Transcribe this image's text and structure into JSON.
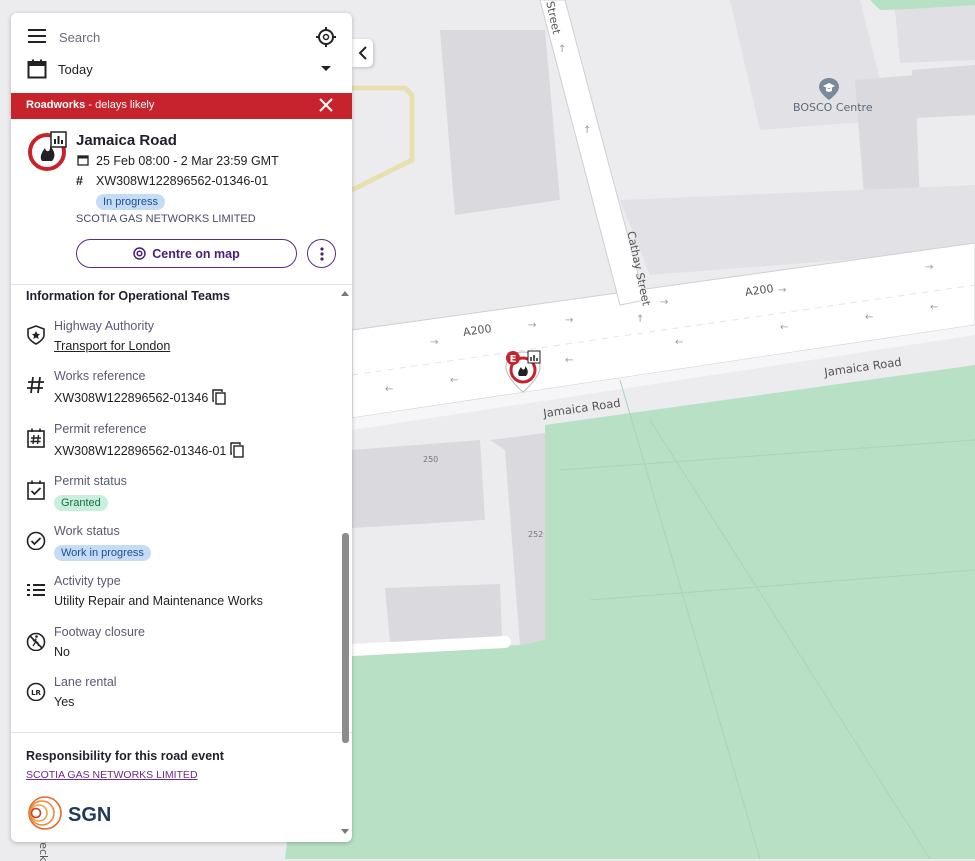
{
  "map": {
    "streets": {
      "street_top": "Street",
      "cathay_street": "Cathay Street",
      "a200_left": "A200",
      "a200_right": "A200",
      "jamaica_road_right": "Jamaica Road",
      "jamaica_road_left": "Jamaica Road",
      "peck_street": "Peck"
    },
    "poi": {
      "bosco_centre": "BOSCO Centre"
    },
    "building_numbers": {
      "n250": "250",
      "n252": "252"
    },
    "colors": {
      "park": "#b7e0c4",
      "road": "#ffffff",
      "building": "#d9d9de",
      "base": "#ececef"
    }
  },
  "search": {
    "placeholder": "Search",
    "value": ""
  },
  "date_filter": {
    "value": "Today"
  },
  "banner": {
    "bold": "Roadworks",
    "rest": " - delays likely",
    "color": "#c7232c"
  },
  "event": {
    "title": "Jamaica Road",
    "dates": "25 Feb 08:00 - 2 Mar 23:59 GMT",
    "reference": "XW308W122896562-01346-01",
    "status": "In progress",
    "organisation": "SCOTIA GAS NETWORKS LIMITED",
    "centre_button": "Centre on map"
  },
  "info": {
    "heading": "Information for Operational Teams",
    "items": [
      {
        "label": "Highway Authority",
        "value": "Transport for London",
        "icon": "shield-star-icon"
      },
      {
        "label": "Works reference",
        "value": "XW308W122896562-01346",
        "icon": "hash-icon"
      },
      {
        "label": "Permit reference",
        "value": "XW308W122896562-01346-01",
        "icon": "permit-hash-icon"
      },
      {
        "label": "Permit status",
        "value": "Granted",
        "icon": "clipboard-check-icon"
      },
      {
        "label": "Work status",
        "value": "Work in progress",
        "icon": "check-circle-icon"
      },
      {
        "label": "Activity type",
        "value": "Utility Repair and Maintenance Works",
        "icon": "list-icon"
      },
      {
        "label": "Footway closure",
        "value": "No",
        "icon": "no-pedestrian-icon"
      },
      {
        "label": "Lane rental",
        "value": "Yes",
        "icon": "lane-rental-icon"
      }
    ]
  },
  "responsibility": {
    "heading": "Responsibility for this road event",
    "link": "SCOTIA GAS NETWORKS LIMITED",
    "logo_text": "SGN",
    "lane_rental_badge": "LR"
  },
  "marker": {
    "letter": "E"
  }
}
